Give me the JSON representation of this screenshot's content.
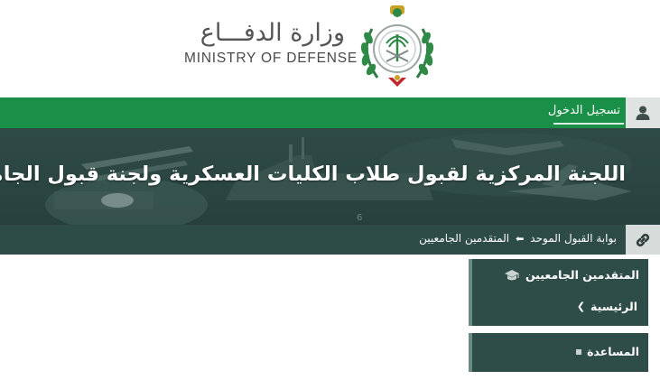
{
  "header": {
    "ministry_name_ar": "وزارة الدفـــاع",
    "ministry_name_en": "MINISTRY OF DEFENSE",
    "emblem_icon": "ministry-emblem-icon"
  },
  "login_bar": {
    "login_label": "تسجيل الدخول",
    "icon": "user-icon",
    "color": "#1a8f47"
  },
  "banner": {
    "title": "اللجنة المركزية لقبول طلاب الكليات العسكرية ولجنة قبول الجامعيين"
  },
  "breadcrumb": {
    "icon": "link-icon",
    "items": [
      {
        "label": "بوابة القبول الموحد"
      },
      {
        "label": "المتقدمين الجامعيين"
      }
    ]
  },
  "side_menu": {
    "section_title": "المتقدمين الجامعيين",
    "section_icon": "graduation-cap-icon",
    "home_label": "الرئيسية",
    "help_label": "المساعدة"
  },
  "colors": {
    "brand_green": "#1a8f47",
    "dark_teal": "#2e4c47"
  }
}
